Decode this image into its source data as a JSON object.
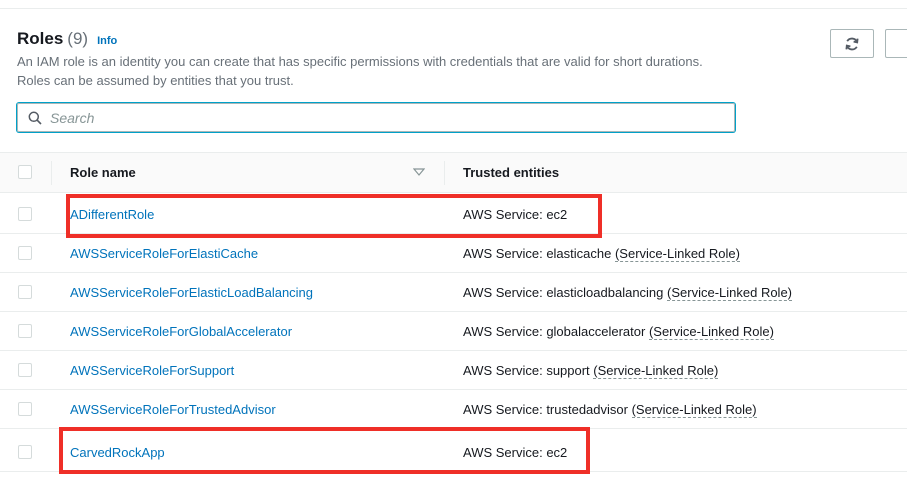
{
  "header": {
    "title": "Roles",
    "count": "(9)",
    "info": "Info",
    "description": "An IAM role is an identity you can create that has specific permissions with credentials that are valid for short durations. Roles can be assumed by entities that you trust."
  },
  "search": {
    "placeholder": "Search",
    "value": ""
  },
  "table": {
    "columns": [
      "Role name",
      "Trusted entities"
    ],
    "rows": [
      {
        "name": "ADifferentRole",
        "service": "AWS Service: ec2",
        "linked": ""
      },
      {
        "name": "AWSServiceRoleForElastiCache",
        "service": "AWS Service: elasticache ",
        "linked": "(Service-Linked Role)"
      },
      {
        "name": "AWSServiceRoleForElasticLoadBalancing",
        "service": "AWS Service: elasticloadbalancing ",
        "linked": "(Service-Linked Role)"
      },
      {
        "name": "AWSServiceRoleForGlobalAccelerator",
        "service": "AWS Service: globalaccelerator ",
        "linked": "(Service-Linked Role)"
      },
      {
        "name": "AWSServiceRoleForSupport",
        "service": "AWS Service: support ",
        "linked": "(Service-Linked Role)"
      },
      {
        "name": "AWSServiceRoleForTrustedAdvisor",
        "service": "AWS Service: trustedadvisor ",
        "linked": "(Service-Linked Role)"
      },
      {
        "name": "CarvedRockApp",
        "service": "AWS Service: ec2",
        "linked": ""
      }
    ]
  },
  "colors": {
    "link": "#0073bb",
    "highlight": "#ef2f28"
  },
  "icons": {
    "refresh": "refresh-icon",
    "search": "search-icon",
    "sort": "sort-down-icon"
  }
}
